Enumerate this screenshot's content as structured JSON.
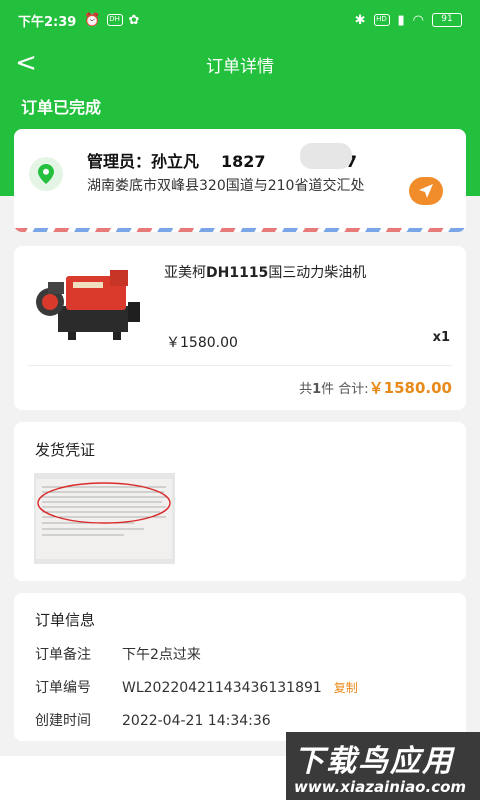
{
  "status_bar": {
    "time": "下午2:39",
    "badge_dh": "DH",
    "battery": "91"
  },
  "header": {
    "back": "<",
    "title": "订单详情"
  },
  "order_status": "订单已完成",
  "address": {
    "contact_name": "管理员：孙立凡",
    "phone_prefix": "1827",
    "phone_suffix": "337",
    "full_address": "湖南娄底市双峰县320国道与210省道交汇处"
  },
  "product": {
    "name_prefix": "亚美柯",
    "name_bold": "DH1115",
    "name_suffix": "国三动力柴油机",
    "price": "￥1580.00",
    "quantity": "x1",
    "summary_count_prefix": "共",
    "summary_count_num": "1",
    "summary_count_suffix": "件 合计:",
    "total": "￥1580.00"
  },
  "voucher": {
    "title": "发货凭证"
  },
  "order_info": {
    "title": "订单信息",
    "note_label": "订单备注",
    "note_value": "下午2点过来",
    "number_label": "订单编号",
    "number_value": "WL20220421143436131891",
    "copy_label": "复制",
    "created_label": "创建时间",
    "created_value": "2022-04-21 14:34:36"
  },
  "watermark": {
    "main": "下载鸟应用",
    "sub": "www.xiazainiao.com"
  },
  "colors": {
    "brand_green": "#22c03c",
    "accent_orange": "#e88a1a"
  }
}
